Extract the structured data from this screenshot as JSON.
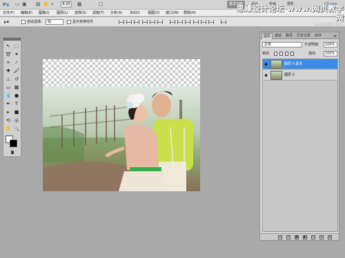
{
  "topbar": {
    "logo": "Ps",
    "zoom": "9.33",
    "workspace_button": "基本功能",
    "workspace_labels": [
      "设计",
      "绘画",
      "摄影"
    ],
    "live_label": "CS Live"
  },
  "watermark": {
    "text": "思缘设计论坛  www.网页教学网",
    "sub": "www.WEBJX.COM"
  },
  "menu": [
    "文件(F)",
    "编辑(E)",
    "图像(I)",
    "图层(L)",
    "选择(S)",
    "滤镜(T)",
    "分析(A)",
    "3D(D)",
    "视图(V)",
    "窗口(W)",
    "帮助(H)"
  ],
  "options": {
    "auto_select_label": "自动选择:",
    "auto_select_value": "组",
    "transform_label": "显示变换控件"
  },
  "tools": [
    {
      "icon": "move-tool-icon",
      "glyph": "↖"
    },
    {
      "icon": "marquee-tool-icon",
      "glyph": "⬚"
    },
    {
      "icon": "lasso-tool-icon",
      "glyph": "➰"
    },
    {
      "icon": "magic-wand-icon",
      "glyph": "✦"
    },
    {
      "icon": "crop-tool-icon",
      "glyph": "⌗"
    },
    {
      "icon": "eyedropper-icon",
      "glyph": "⁄"
    },
    {
      "icon": "healing-brush-icon",
      "glyph": "✚"
    },
    {
      "icon": "brush-tool-icon",
      "glyph": "🖌"
    },
    {
      "icon": "clone-stamp-icon",
      "glyph": "⊥"
    },
    {
      "icon": "history-brush-icon",
      "glyph": "↺"
    },
    {
      "icon": "eraser-tool-icon",
      "glyph": "▭"
    },
    {
      "icon": "gradient-tool-icon",
      "glyph": "▦"
    },
    {
      "icon": "blur-tool-icon",
      "glyph": "💧"
    },
    {
      "icon": "dodge-tool-icon",
      "glyph": "●"
    },
    {
      "icon": "pen-tool-icon",
      "glyph": "✒"
    },
    {
      "icon": "type-tool-icon",
      "glyph": "T"
    },
    {
      "icon": "path-select-icon",
      "glyph": "▸"
    },
    {
      "icon": "shape-tool-icon",
      "glyph": "■"
    },
    {
      "icon": "3d-rotate-icon",
      "glyph": "⟲"
    },
    {
      "icon": "3d-orbit-icon",
      "glyph": "◎"
    },
    {
      "icon": "hand-tool-icon",
      "glyph": "✋"
    },
    {
      "icon": "zoom-tool-icon",
      "glyph": "🔍"
    }
  ],
  "panel": {
    "tabs": [
      "图层",
      "通道",
      "路径",
      "历史记录",
      "动作"
    ],
    "blend_mode": "正常",
    "opacity_label": "不透明度:",
    "opacity_value": "100%",
    "lock_label": "锁定:",
    "fill_label": "填充:",
    "fill_value": "100%",
    "layers": [
      {
        "name": "图层 0 副本",
        "selected": true
      },
      {
        "name": "图层 0",
        "selected": false
      }
    ]
  },
  "colors": {
    "accent": "#3c8ce7",
    "workspace_bg": "#a9a9a9"
  }
}
